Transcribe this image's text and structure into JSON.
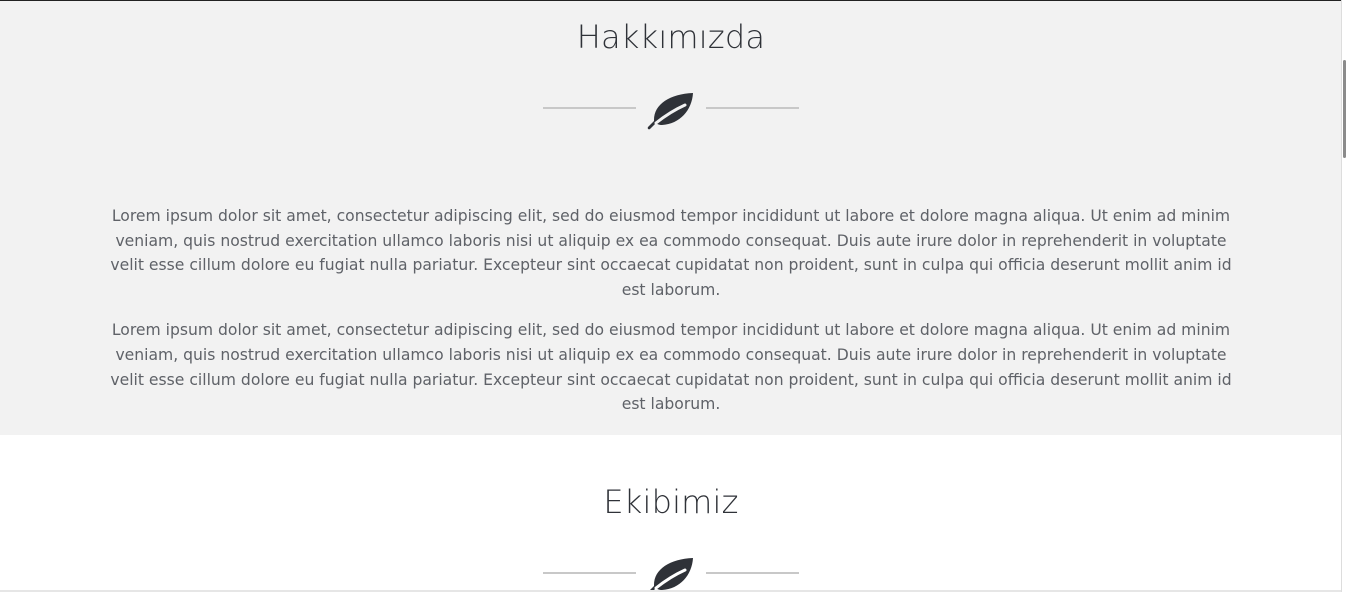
{
  "about": {
    "title": "Hakkımızda",
    "paragraphs": [
      "Lorem ipsum dolor sit amet, consectetur adipiscing elit, sed do eiusmod tempor incididunt ut labore et dolore magna aliqua. Ut enim ad minim veniam, quis nostrud exercitation ullamco laboris nisi ut aliquip ex ea commodo consequat. Duis aute irure dolor in reprehenderit in voluptate velit esse cillum dolore eu fugiat nulla pariatur. Excepteur sint occaecat cupidatat non proident, sunt in culpa qui officia deserunt mollit anim id est laborum.",
      "Lorem ipsum dolor sit amet, consectetur adipiscing elit, sed do eiusmod tempor incididunt ut labore et dolore magna aliqua. Ut enim ad minim veniam, quis nostrud exercitation ullamco laboris nisi ut aliquip ex ea commodo consequat. Duis aute irure dolor in reprehenderit in voluptate velit esse cillum dolore eu fugiat nulla pariatur. Excepteur sint occaecat cupidatat non proident, sunt in culpa qui officia deserunt mollit anim id est laborum."
    ],
    "divider_icon": "leaf-icon"
  },
  "team": {
    "title": "Ekibimiz",
    "divider_icon": "leaf-icon"
  },
  "colors": {
    "about_background": "#f2f2f2",
    "team_background": "#ffffff",
    "title_text": "#2f3238",
    "body_text": "#5f6268",
    "divider_line": "#c8c8c8",
    "icon": "#2f3238"
  }
}
